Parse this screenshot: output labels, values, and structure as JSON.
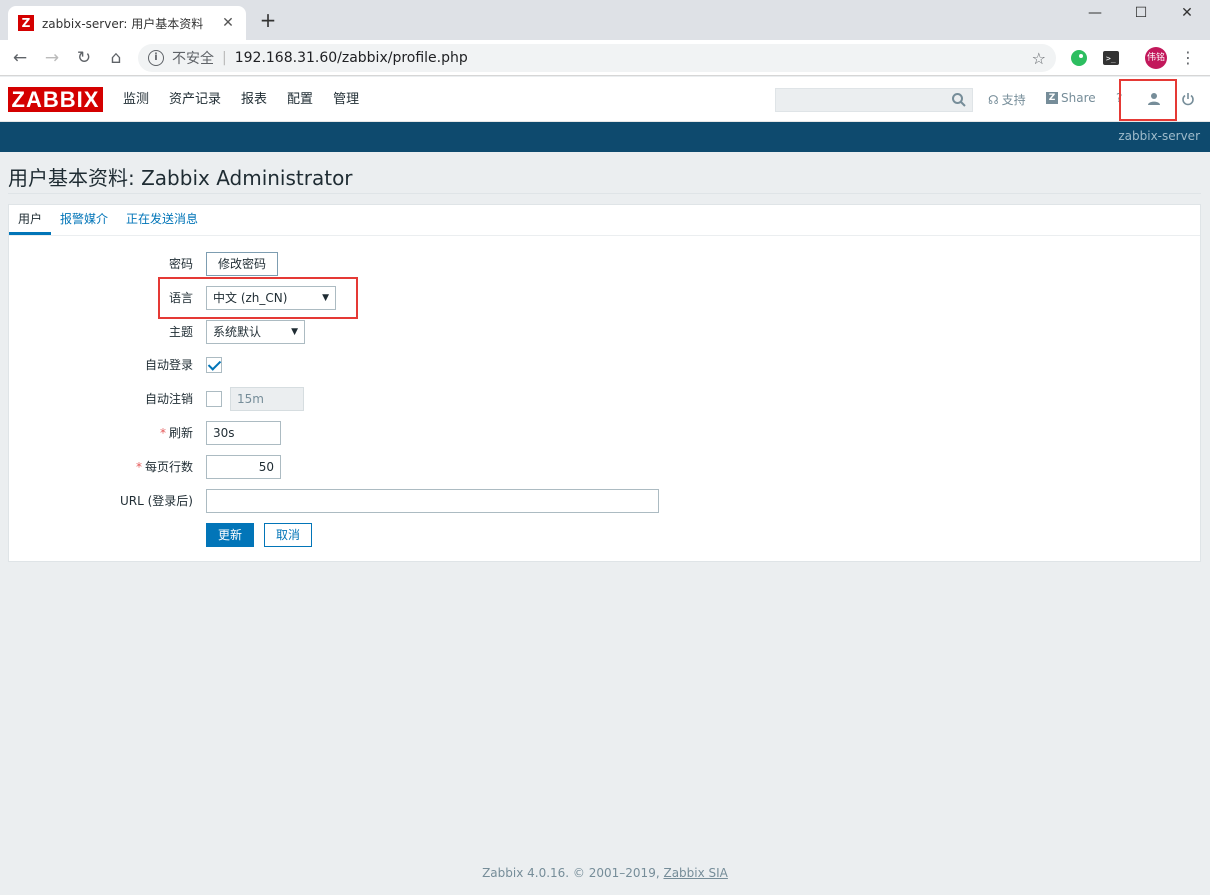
{
  "browser": {
    "tab_title": "zabbix-server: 用户基本资料",
    "tab_close": "✕",
    "new_tab": "+",
    "insecure_label": "不安全",
    "url": "192.168.31.60/zabbix/profile.php",
    "profile_initials": "伟铭",
    "icons": [
      "back-icon",
      "forward-icon",
      "reload-icon",
      "home-icon",
      "info-icon",
      "star-icon",
      "evernote-icon",
      "terminal-icon",
      "menu-icon"
    ]
  },
  "header": {
    "logo": "ZABBIX",
    "menu": [
      "监测",
      "资产记录",
      "报表",
      "配置",
      "管理"
    ],
    "support": "支持",
    "share": "Share",
    "help": "?",
    "server_name": "zabbix-server",
    "colors": {
      "logo": "#d40000",
      "bar": "#0e4a6e",
      "highlight": "#e53935"
    }
  },
  "page": {
    "title": "用户基本资料: Zabbix Administrator",
    "tabs": [
      {
        "label": "用户",
        "active": true
      },
      {
        "label": "报警媒介",
        "active": false
      },
      {
        "label": "正在发送消息",
        "active": false
      }
    ]
  },
  "form": {
    "password_label": "密码",
    "change_password_button": "修改密码",
    "language_label": "语言",
    "language_value": "中文 (zh_CN)",
    "theme_label": "主题",
    "theme_value": "系统默认",
    "autologin_label": "自动登录",
    "autologin_checked": true,
    "autologout_label": "自动注销",
    "autologout_checked": false,
    "autologout_value": "15m",
    "refresh_label": "刷新",
    "refresh_value": "30s",
    "rows_label": "每页行数",
    "rows_value": "50",
    "url_label": "URL (登录后)",
    "url_value": "",
    "required_mark": "*",
    "update_button": "更新",
    "cancel_button": "取消"
  },
  "footer": {
    "text": "Zabbix 4.0.16. © 2001–2019, ",
    "link": "Zabbix SIA"
  }
}
